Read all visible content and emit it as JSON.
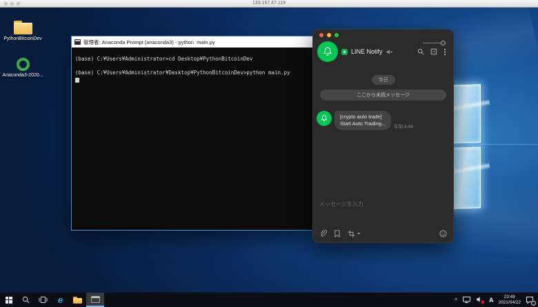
{
  "remote_window": {
    "title_ip": "133.167.47.119"
  },
  "desktop": {
    "icons": [
      {
        "label": "PythonBitcoinDev",
        "kind": "folder"
      },
      {
        "label": "Anaconda3-2020...",
        "kind": "anaconda-installer"
      }
    ]
  },
  "terminal": {
    "title": "管理者: Anaconda Prompt (anaconda3) - python  main.py",
    "lines": [
      "(base) C:¥Users¥Administrator>cd Desktop¥PythonBitcoinDev",
      "",
      "(base) C:¥Users¥Administrator¥Desktop¥PythonBitcoinDev>python main.py"
    ]
  },
  "line_app": {
    "contact_name": "LINE Notify",
    "date_separator": "今日",
    "unread_separator": "ここから未読メッセージ",
    "message": {
      "text_line1": "[crypto auto trade]",
      "text_line2": "Start Auto Trading...",
      "time": "午前 8:49"
    },
    "composer_placeholder": "メッセージを入力"
  },
  "taskbar": {
    "tray": {
      "overflow_chevron": "^",
      "ime_indicator": "A",
      "time": "23:49",
      "date": "2021/04/22"
    },
    "ie_glyph": "e"
  },
  "colors": {
    "line_green": "#06c755",
    "window_accent_blue": "#4a90d9",
    "wallpaper_blue": "#15498c",
    "taskbar_bg": "#0d0d15",
    "mac_traffic_red": "#ff5f57",
    "mac_traffic_yellow": "#febc2e",
    "mac_traffic_green": "#28c840",
    "mute_badge_red": "#e81123"
  }
}
